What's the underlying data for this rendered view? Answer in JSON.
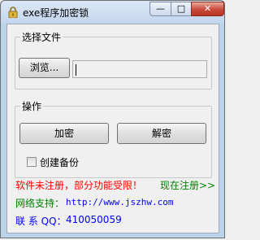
{
  "window": {
    "title": "exe程序加密锁",
    "min_glyph": "—",
    "max_glyph": "□",
    "close_glyph": "✕"
  },
  "file_group": {
    "label": "选择文件",
    "browse_label": "浏览...",
    "path_value": ""
  },
  "ops_group": {
    "label": "操作",
    "encrypt_label": "加密",
    "decrypt_label": "解密",
    "backup_label": "创建备份",
    "backup_checked": false
  },
  "info": {
    "unregistered_text": "软件未注册，部分功能受限！",
    "register_link": "现在注册>>",
    "support_label": "网络支持：",
    "support_url": "http://www.jszhw.com",
    "contact_label": "联 系 QQ：",
    "contact_qq": "410050059"
  },
  "colors": {
    "warning": "#ff0000",
    "register": "#008000",
    "support": "#008000",
    "contact": "#0000ff"
  }
}
